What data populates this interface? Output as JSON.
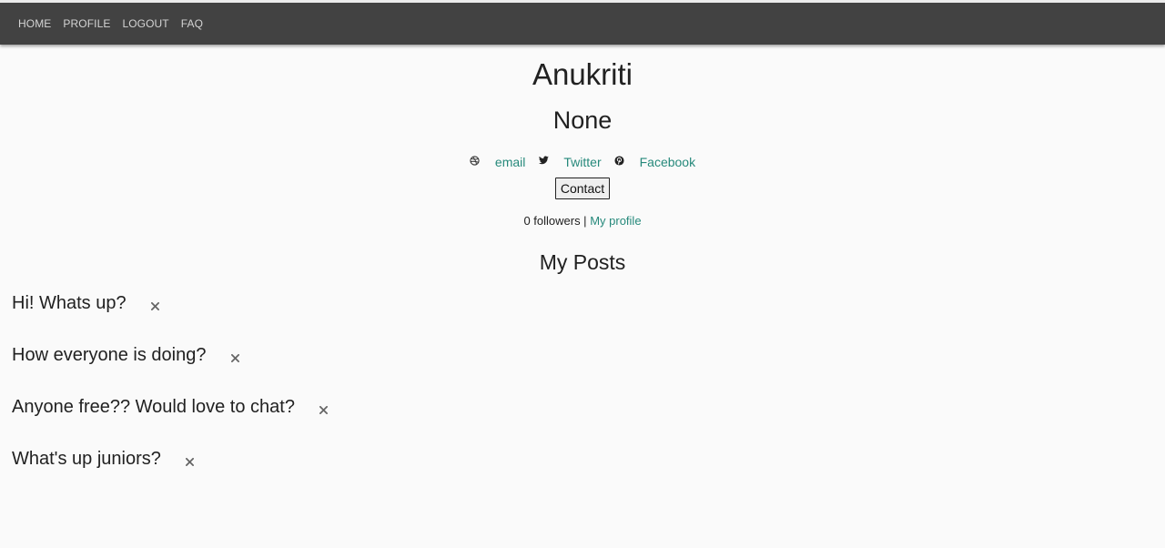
{
  "nav": {
    "items": [
      {
        "label": "HOME"
      },
      {
        "label": "PROFILE"
      },
      {
        "label": "LOGOUT"
      },
      {
        "label": "FAQ"
      }
    ]
  },
  "profile": {
    "name": "Anukriti",
    "subtitle": "None",
    "social": [
      {
        "icon": "dribbble-icon",
        "label": "email"
      },
      {
        "icon": "twitter-icon",
        "label": "Twitter"
      },
      {
        "icon": "pinterest-icon",
        "label": "Facebook"
      }
    ],
    "contact_label": "Contact",
    "followers_text": "0 followers |",
    "my_profile_label": "My profile"
  },
  "posts": {
    "title": "My Posts",
    "items": [
      {
        "text": "Hi! Whats up?"
      },
      {
        "text": "How everyone is doing?"
      },
      {
        "text": "Anyone free?? Would love to chat?"
      },
      {
        "text": "What's up juniors?"
      }
    ]
  },
  "colors": {
    "navbar": "#424242",
    "link": "#26897b",
    "background": "#fafafa"
  }
}
